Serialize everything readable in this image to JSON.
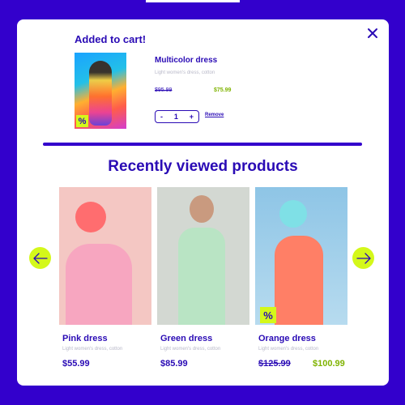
{
  "cart": {
    "title": "Added to cart!",
    "product_name": "Multicolor dress",
    "product_sub": "Light women's dress, cotton",
    "old_price": "$95.99",
    "new_price": "$75.99",
    "quantity": "1",
    "minus": "-",
    "plus": "+",
    "remove_label": "Remove",
    "badge": "%"
  },
  "section_title": "Recently viewed products",
  "products": [
    {
      "name": "Pink dress",
      "sub": "Light women's dress, cotton",
      "price": "$55.99"
    },
    {
      "name": "Green dress",
      "sub": "Light women's dress, cotton",
      "price": "$85.99"
    },
    {
      "name": "Orange dress",
      "sub": "Light women's dress, cotton",
      "old_price": "$125.99",
      "new_price": "$100.99",
      "badge": "%"
    }
  ],
  "icons": {
    "close": "close-icon",
    "prev": "arrow-left-icon",
    "next": "arrow-right-icon"
  },
  "colors": {
    "background": "#3300cc",
    "accent": "#d4f81a",
    "text_primary": "#2a0bb5",
    "sale_price": "#7fb300"
  }
}
